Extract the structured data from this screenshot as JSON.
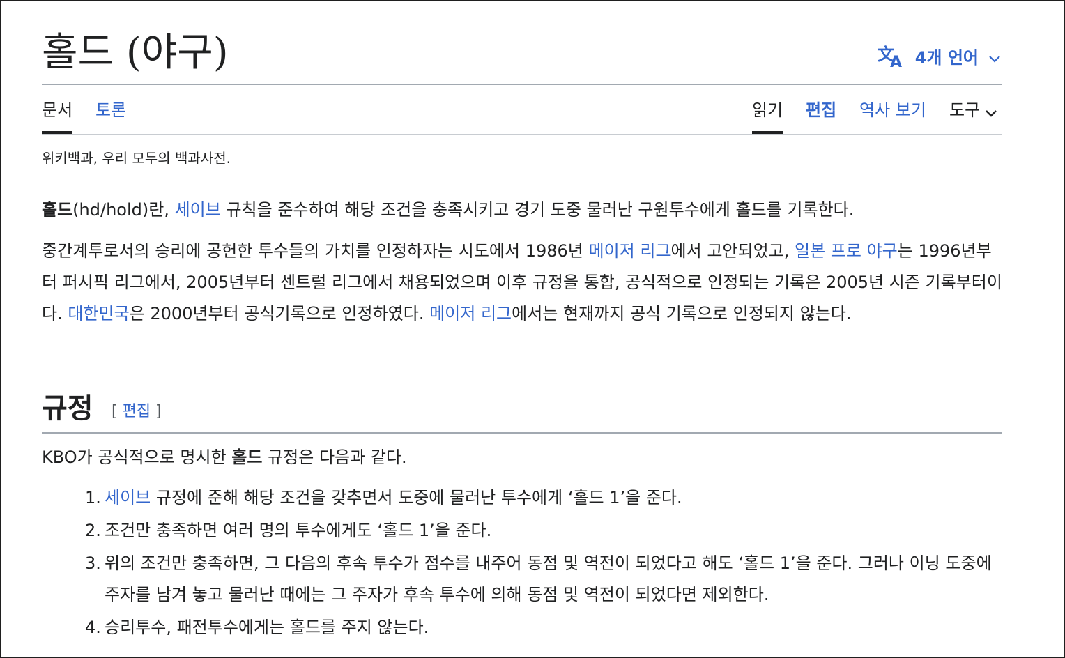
{
  "header": {
    "title": "홀드 (야구)",
    "language_button": "4개 언어",
    "icons": {
      "language": "translate-icon",
      "dropdown": "chevron-down-icon"
    }
  },
  "tabs": {
    "article": "문서",
    "talk": "토론",
    "read": "읽기",
    "edit": "편집",
    "history": "역사 보기",
    "tools": "도구"
  },
  "tagline": "위키백과, 우리 모두의 백과사전.",
  "intro": {
    "p1_bold": "홀드",
    "p1_a": "(hd/hold)란, ",
    "p1_link": "세이브",
    "p1_b": " 규칙을 준수하여 해당 조건을 충족시키고 경기 도중 물러난 구원투수에게 홀드를 기록한다.",
    "p2_a": "중간계투로서의 승리에 공헌한 투수들의 가치를 인정하자는 시도에서 1986년 ",
    "p2_link1": "메이저 리그",
    "p2_b": "에서 고안되었고, ",
    "p2_link2": "일본 프로 야구",
    "p2_c": "는 1996년부터 퍼시픽 리그에서, 2005년부터 센트럴 리그에서 채용되었으며 이후 규정을 통합, 공식적으로 인정되는 기록은 2005년 시즌 기록부터이다. ",
    "p2_link3": "대한민국",
    "p2_d": "은 2000년부터 공식기록으로 인정하였다. ",
    "p2_link4": "메이저 리그",
    "p2_e": "에서는 현재까지 공식 기록으로 인정되지 않는다."
  },
  "section": {
    "heading": "규정",
    "edit_open": "[ ",
    "edit_label": "편집",
    "edit_close": " ]",
    "lead_a": "KBO가 공식적으로 명시한 ",
    "lead_bold": "홀드",
    "lead_b": " 규정은 다음과 같다.",
    "rules": [
      {
        "num": "1.",
        "link": "세이브",
        "text": " 규정에 준해 해당 조건을 갖추면서 도중에 물러난 투수에게 ‘홀드 1’을 준다."
      },
      {
        "num": "2.",
        "link": "",
        "text": "조건만 충족하면 여러 명의 투수에게도 ‘홀드 1’을 준다."
      },
      {
        "num": "3.",
        "link": "",
        "text": "위의 조건만 충족하면, 그 다음의 후속 투수가 점수를 내주어 동점 및 역전이 되었다고 해도 ‘홀드 1’을 준다. 그러나 이닝 도중에 주자를 남겨 놓고 물러난 때에는 그 주자가 후속 투수에 의해 동점 및 역전이 되었다면 제외한다."
      },
      {
        "num": "4.",
        "link": "",
        "text": "승리투수, 패전투수에게는 홀드를 주지 않는다."
      }
    ]
  },
  "colors": {
    "link": "#3366cc",
    "text": "#202122",
    "rule": "#a2a9b1"
  }
}
